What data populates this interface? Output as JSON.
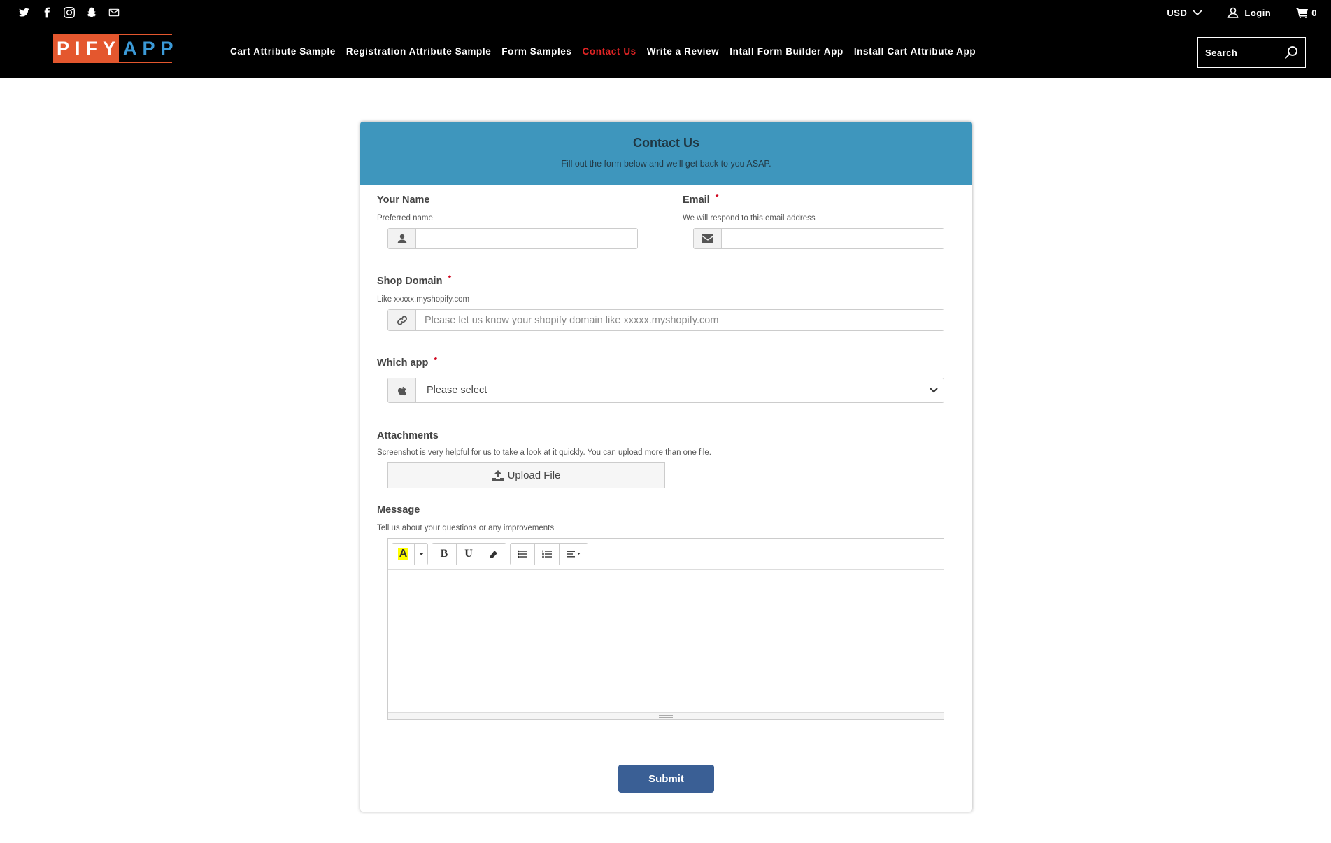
{
  "header": {
    "social_icons": [
      "twitter-icon",
      "facebook-icon",
      "instagram-icon",
      "snapchat-icon",
      "mail-icon"
    ],
    "currency": "USD",
    "login_label": "Login",
    "cart_count": "0",
    "logo": {
      "part1": "PIFY",
      "part2": "APP"
    },
    "nav": [
      {
        "label": "Cart Attribute Sample"
      },
      {
        "label": "Registration Attribute Sample"
      },
      {
        "label": "Form Samples"
      },
      {
        "label": "Contact Us",
        "active": true
      },
      {
        "label": "Write a Review"
      },
      {
        "label": "Intall Form Builder App"
      },
      {
        "label": "Install Cart Attribute App"
      }
    ],
    "search_placeholder": "Search"
  },
  "form": {
    "title": "Contact Us",
    "subtitle": "Fill out the form below and we'll get back to you ASAP.",
    "name": {
      "label": "Your Name",
      "help": "Preferred name",
      "value": "",
      "icon": "user-icon"
    },
    "email": {
      "label": "Email",
      "required": "*",
      "help": "We will respond to this email address",
      "value": "",
      "icon": "envelope-icon"
    },
    "shop_domain": {
      "label": "Shop Domain",
      "required": "*",
      "help": "Like xxxxx.myshopify.com",
      "placeholder": "Please let us know your shopify domain like xxxxx.myshopify.com",
      "icon": "link-icon"
    },
    "which_app": {
      "label": "Which app",
      "required": "*",
      "selected": "Please select",
      "icon": "apple-icon"
    },
    "attachments": {
      "label": "Attachments",
      "help": "Screenshot is very helpful for us to take a look at it quickly. You can upload more than one file.",
      "button": "Upload File"
    },
    "message": {
      "label": "Message",
      "help": "Tell us about your questions or any improvements",
      "toolbar": {
        "color": "A",
        "bold": "B",
        "underline": "U"
      }
    },
    "submit_label": "Submit"
  },
  "colors": {
    "header_bg": "#000000",
    "card_header": "#3e96bd",
    "submit": "#3a5f95",
    "active_nav": "#e02424",
    "logo_orange": "#e4572e",
    "logo_blue": "#3b9ad8"
  }
}
